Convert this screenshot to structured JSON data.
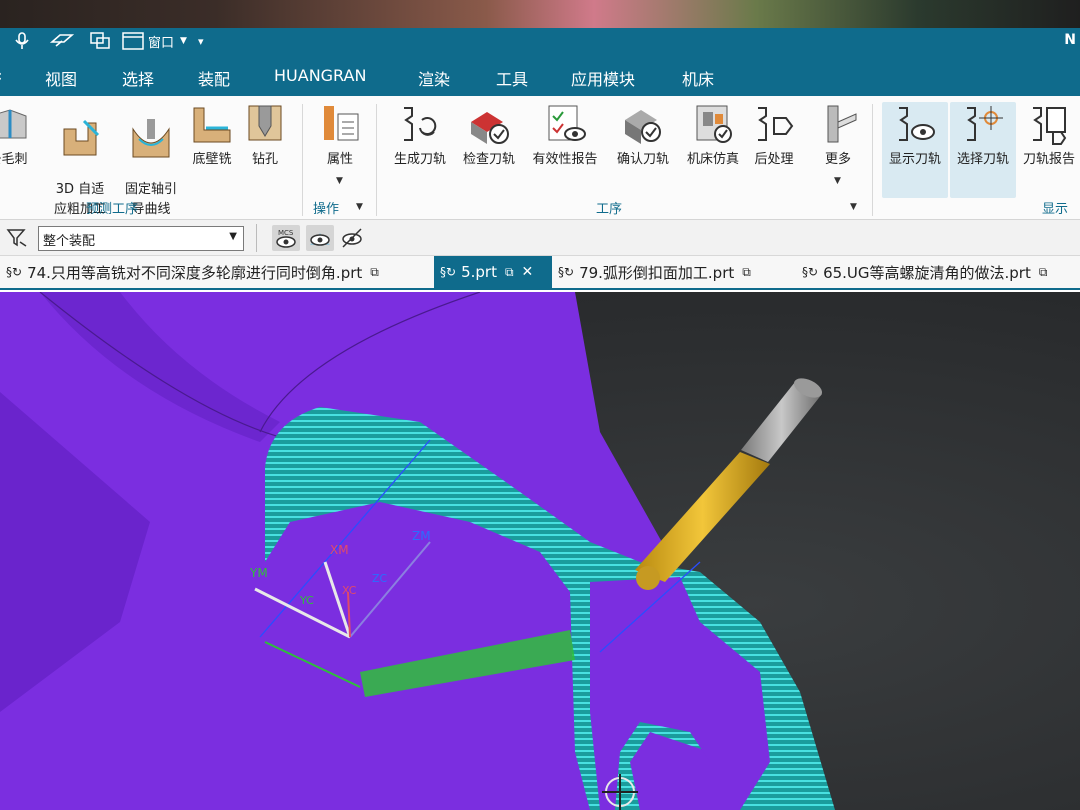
{
  "titlebar": {
    "window_menu": "窗口",
    "app_letter": "N"
  },
  "menubar": {
    "items": [
      "视图",
      "选择",
      "装配",
      "HUANGRAN",
      "渲染",
      "工具",
      "应用模块",
      "机床"
    ]
  },
  "ribbon": {
    "groups": [
      {
        "label": "预测工序",
        "buttons": [
          "去毛刺",
          "3D 自适\n应粗加工",
          "固定轴引\n导曲线",
          "底壁铣",
          "钻孔"
        ]
      },
      {
        "label": "操作",
        "buttons": [
          "属性"
        ]
      },
      {
        "label": "工序",
        "buttons": [
          "生成刀轨",
          "检查刀轨",
          "有效性报告",
          "确认刀轨",
          "机床仿真",
          "后处理",
          "更多"
        ]
      },
      {
        "label": "显示",
        "buttons": [
          "显示刀轨",
          "选择刀轨",
          "刀轨报告"
        ]
      }
    ]
  },
  "selection": {
    "filter_value": "整个装配",
    "mcs_label": "MCS"
  },
  "tabs": [
    {
      "label": "74.只用等高铣对不同深度多轮廓进行同时倒角.prt",
      "active": false
    },
    {
      "label": "5.prt",
      "active": true
    },
    {
      "label": "79.弧形倒扣面加工.prt",
      "active": false
    },
    {
      "label": "65.UG等高螺旋清角的做法.prt",
      "active": false
    }
  ],
  "viewport": {
    "axis_labels": [
      "YM",
      "XM",
      "ZM",
      "ZC",
      "XC",
      "YC"
    ]
  },
  "colors": {
    "accent": "#0f6b8c",
    "part": "#7b2ee0",
    "toolpath": "#31e6e6",
    "tool": "#e0b12a"
  }
}
